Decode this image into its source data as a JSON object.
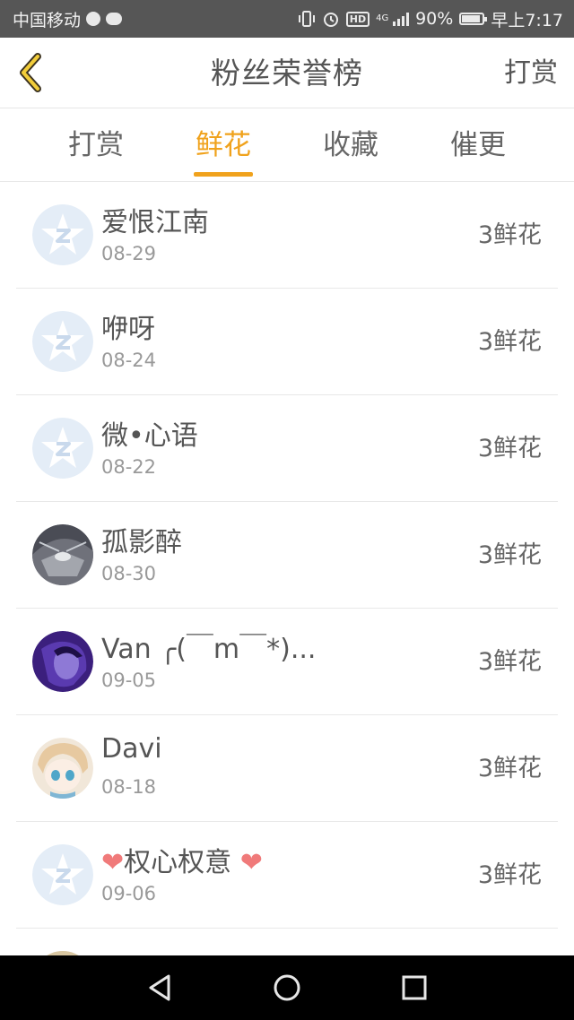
{
  "status_bar": {
    "carrier": "中国移动",
    "network_badge": "HD",
    "signal_label": "4G",
    "battery": "90%",
    "battery_level": 0.9,
    "time": "早上7:17",
    "icons": [
      "globe-icon",
      "chat-icon",
      "vibrate-icon",
      "alarm-icon",
      "hd-icon",
      "signal-icon",
      "battery-icon"
    ]
  },
  "header": {
    "title": "粉丝荣誉榜",
    "action": "打赏",
    "back_icon": "chevron-left-icon",
    "accent": "#f0a21c"
  },
  "tabs": [
    {
      "label": "打赏",
      "active": false
    },
    {
      "label": "鲜花",
      "active": true
    },
    {
      "label": "收藏",
      "active": false
    },
    {
      "label": "催更",
      "active": false
    }
  ],
  "fans": [
    {
      "name": "爱恨江南",
      "date": "08-29",
      "amount": "3鲜花",
      "avatar": "default-star-avatar"
    },
    {
      "name": "咿呀",
      "date": "08-24",
      "amount": "3鲜花",
      "avatar": "default-star-avatar"
    },
    {
      "name": "微•心语",
      "date": "08-22",
      "amount": "3鲜花",
      "avatar": "default-star-avatar"
    },
    {
      "name": "孤影醉",
      "date": "08-30",
      "amount": "3鲜花",
      "avatar": "tunnel-photo-avatar"
    },
    {
      "name": "Van ╭(￣m￣*)...",
      "date": "09-05",
      "amount": "3鲜花",
      "avatar": "purple-photo-avatar"
    },
    {
      "name": "Davi",
      "date": "08-18",
      "amount": "3鲜花",
      "avatar": "anime-girl-avatar"
    },
    {
      "name_prefix": "❤",
      "name": "权心权意",
      "name_suffix": "❤",
      "date": "09-06",
      "amount": "3鲜花",
      "avatar": "default-star-avatar"
    }
  ],
  "system_nav": {
    "icons": [
      "back-triangle-icon",
      "home-circle-icon",
      "recents-square-icon"
    ]
  }
}
